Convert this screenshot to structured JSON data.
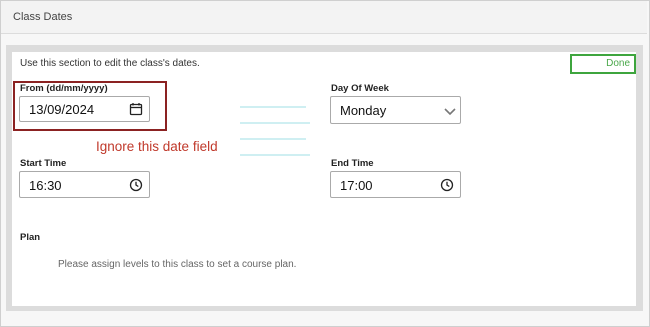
{
  "header": {
    "title": "Class Dates"
  },
  "intro": "Use this section to edit the class's dates.",
  "done_label": "Done",
  "from": {
    "label": "From (dd/mm/yyyy)",
    "value": "13/09/2024"
  },
  "day_of_week": {
    "label": "Day Of Week",
    "value": "Monday"
  },
  "start_time": {
    "label": "Start Time",
    "value": "16:30"
  },
  "end_time": {
    "label": "End Time",
    "value": "17:00"
  },
  "annotation": "Ignore this date field",
  "plan": {
    "label": "Plan",
    "message": "Please assign levels to this class to set a course plan."
  },
  "colors": {
    "highlight": "#8b2222",
    "annotation": "#c0392b",
    "done_border": "#3ea53e",
    "done_text": "#4aa84a"
  }
}
